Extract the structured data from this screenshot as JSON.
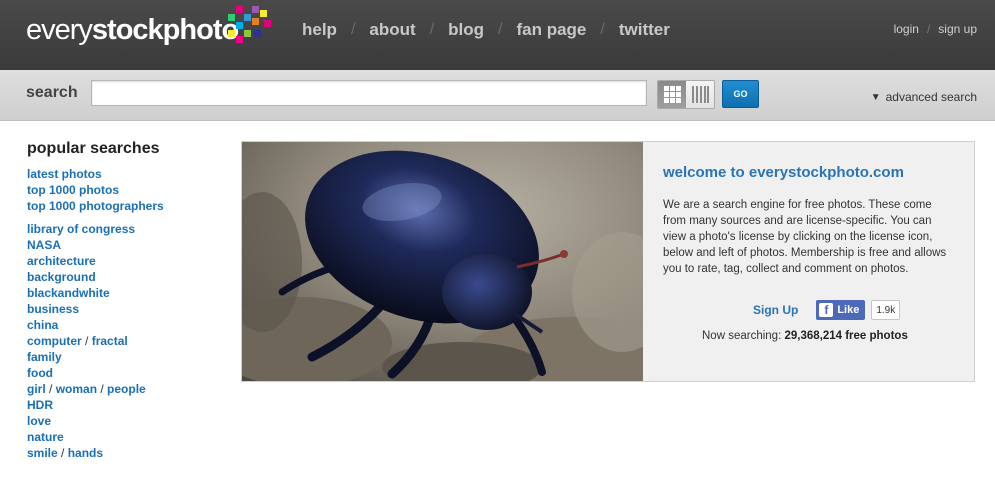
{
  "header": {
    "logo_thin": "every",
    "logo_bold": "stockphoto",
    "nav": [
      "help",
      "about",
      "blog",
      "fan page",
      "twitter"
    ],
    "login": "login",
    "signup": "sign up"
  },
  "search": {
    "label": "search",
    "placeholder": "",
    "value": "",
    "go_label": "GO",
    "advanced_label": "advanced search"
  },
  "sidebar": {
    "title": "popular searches",
    "group1": [
      "latest photos",
      "top 1000 photos",
      "top 1000 photographers"
    ],
    "group2": {
      "library_of_congress": "library of congress",
      "nasa": "NASA",
      "architecture": "architecture",
      "background": "background",
      "blackandwhite": "blackandwhite",
      "business": "business",
      "china": "china",
      "computer": "computer",
      "fractal": "fractal",
      "family": "family",
      "food": "food",
      "girl": "girl",
      "woman": "woman",
      "people": "people",
      "hdr": "HDR",
      "love": "love",
      "nature": "nature",
      "smile": "smile",
      "hands": "hands"
    }
  },
  "welcome": {
    "title": "welcome to everystockphoto.com",
    "body": "We are a search engine for free photos. These come from many sources and are license-specific. You can view a photo's license by clicking on the license icon, below and left of photos. Membership is free and allows you to rate, tag, collect and comment on photos.",
    "signup_label": "Sign Up",
    "like_label": "Like",
    "like_count": "1.9k",
    "now_searching_label": "Now searching:",
    "now_searching_value": "29,368,214 free photos"
  },
  "colors": {
    "link": "#1a6fb5",
    "go_button": "#1580c4",
    "facebook": "#4c69ba",
    "topbar": "#424242"
  },
  "icons": [
    "grid-view-icon",
    "column-view-icon",
    "advanced-search-arrow-icon",
    "facebook-icon"
  ]
}
